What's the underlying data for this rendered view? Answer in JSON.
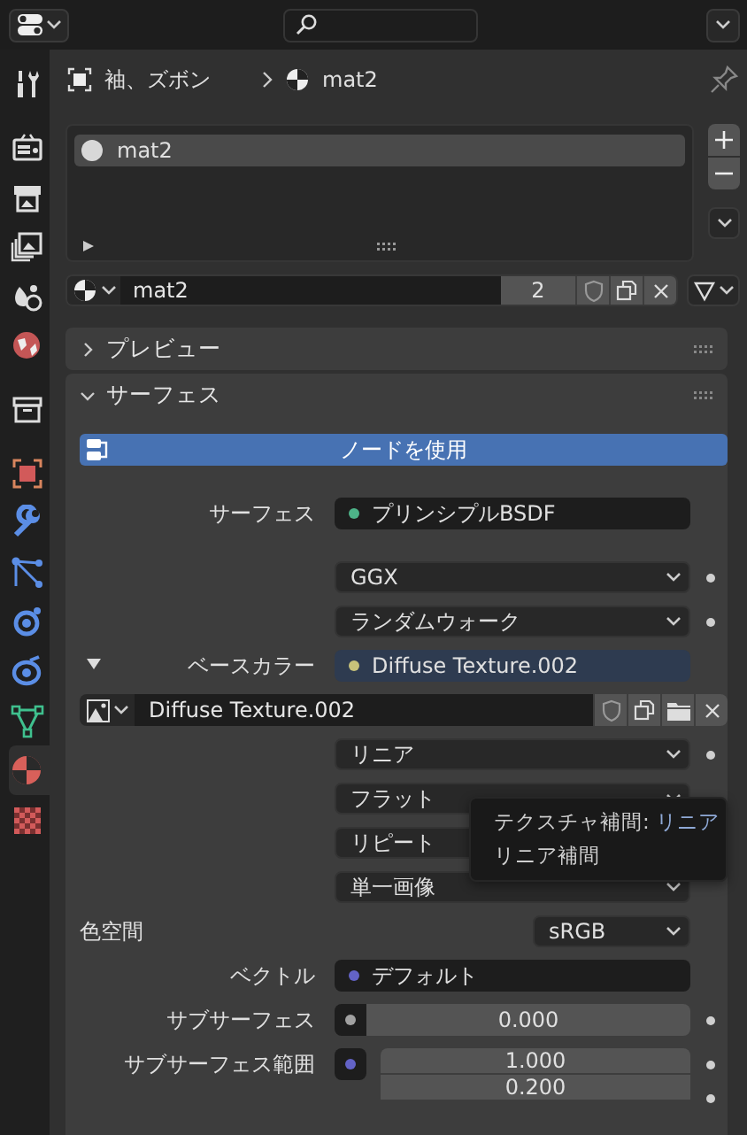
{
  "sidebar": {
    "groups": [
      {
        "tabs": [
          {
            "kind": "tool",
            "selected": false
          }
        ]
      },
      {
        "tabs": [
          {
            "kind": "render",
            "selected": false
          },
          {
            "kind": "output",
            "selected": false
          },
          {
            "kind": "view_layer",
            "selected": false
          },
          {
            "kind": "scene",
            "selected": false
          },
          {
            "kind": "world",
            "selected": false
          }
        ]
      },
      {
        "tabs": [
          {
            "kind": "collection",
            "selected": false
          }
        ]
      },
      {
        "tabs": [
          {
            "kind": "object",
            "selected": false
          },
          {
            "kind": "modifier",
            "selected": false
          },
          {
            "kind": "particles",
            "selected": false
          },
          {
            "kind": "physics",
            "selected": false
          },
          {
            "kind": "constraints",
            "selected": false
          },
          {
            "kind": "data",
            "selected": false
          },
          {
            "kind": "material",
            "selected": true
          },
          {
            "kind": "texture",
            "selected": false
          }
        ]
      }
    ]
  },
  "breadcrumb": {
    "object": "袖、ズボン",
    "material": "mat2"
  },
  "slot_list": {
    "items": [
      {
        "name": "mat2",
        "selected": true
      }
    ]
  },
  "material_selector": {
    "name": "mat2",
    "users": "2"
  },
  "panels": [
    {
      "title": "プレビュー",
      "expanded": false
    },
    {
      "title": "サーフェス",
      "expanded": true
    }
  ],
  "use_nodes_button": {
    "label": "ノードを使用",
    "on": true
  },
  "properties": [
    {
      "kind": "link",
      "label": "サーフェス",
      "value": "プリンシプルBSDF",
      "color": "#4db388"
    },
    {
      "kind": "dropdown",
      "value": "GGX",
      "keyframe": true
    },
    {
      "kind": "dropdown",
      "value": "ランダムウォーク",
      "keyframe": true
    },
    {
      "kind": "link",
      "label": "ベースカラー",
      "value": "Diffuse Texture.002",
      "color": "#c7c27a",
      "expanded": true
    },
    {
      "kind": "image",
      "name": "Diffuse Texture.002"
    },
    {
      "kind": "dropdown",
      "value": "リニア",
      "keyframe": true
    },
    {
      "kind": "dropdown",
      "value": "フラット",
      "keyframe": false
    },
    {
      "kind": "dropdown",
      "value": "リピート",
      "keyframe": false
    },
    {
      "kind": "dropdown",
      "value": "単一画像",
      "keyframe": false
    },
    {
      "kind": "enum",
      "label": "色空間",
      "value": "sRGB"
    },
    {
      "kind": "link",
      "label": "ベクトル",
      "value": "デフォルト",
      "color": "#6363c7"
    },
    {
      "kind": "number",
      "label": "サブサーフェス",
      "value": "0.000",
      "color": "#a1a1a1",
      "keyframe": true
    },
    {
      "kind": "vector",
      "label": "サブサーフェス範囲",
      "color": "#6363c7",
      "values": [
        "1.000",
        "0.200"
      ],
      "keyframe": true
    }
  ],
  "tooltip": {
    "title": "テクスチャ補間:",
    "value": "リニア",
    "description": "リニア補間"
  }
}
